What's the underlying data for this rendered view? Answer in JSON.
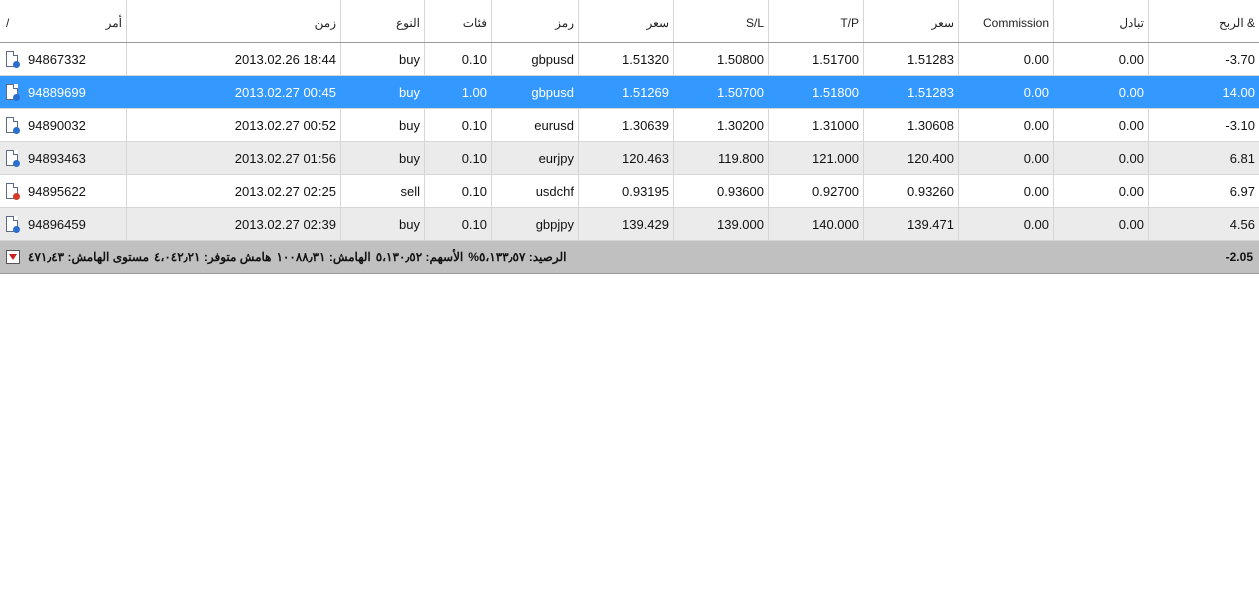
{
  "columns": {
    "order": "أمر",
    "sort_mark": "/",
    "time": "زمن",
    "type": "النوع",
    "lots": "فئات",
    "symbol": "رمز",
    "price_open": "سعر",
    "sl": "S/L",
    "tp": "T/P",
    "price_current": "سعر",
    "commission": "Commission",
    "swap": "تبادل",
    "profit": "الربح &"
  },
  "trades": [
    {
      "order": "94867332",
      "time": "2013.02.26 18:44",
      "type": "buy",
      "lots": "0.10",
      "symbol": "gbpusd",
      "price_open": "1.51320",
      "sl": "1.50800",
      "tp": "1.51700",
      "price_current": "1.51283",
      "commission": "0.00",
      "swap": "0.00",
      "profit": "-3.70"
    },
    {
      "order": "94889699",
      "time": "2013.02.27 00:45",
      "type": "buy",
      "lots": "1.00",
      "symbol": "gbpusd",
      "price_open": "1.51269",
      "sl": "1.50700",
      "tp": "1.51800",
      "price_current": "1.51283",
      "commission": "0.00",
      "swap": "0.00",
      "profit": "14.00"
    },
    {
      "order": "94890032",
      "time": "2013.02.27 00:52",
      "type": "buy",
      "lots": "0.10",
      "symbol": "eurusd",
      "price_open": "1.30639",
      "sl": "1.30200",
      "tp": "1.31000",
      "price_current": "1.30608",
      "commission": "0.00",
      "swap": "0.00",
      "profit": "-3.10"
    },
    {
      "order": "94893463",
      "time": "2013.02.27 01:56",
      "type": "buy",
      "lots": "0.10",
      "symbol": "eurjpy",
      "price_open": "120.463",
      "sl": "119.800",
      "tp": "121.000",
      "price_current": "120.400",
      "commission": "0.00",
      "swap": "0.00",
      "profit": "6.81"
    },
    {
      "order": "94895622",
      "time": "2013.02.27 02:25",
      "type": "sell",
      "lots": "0.10",
      "symbol": "usdchf",
      "price_open": "0.93195",
      "sl": "0.93600",
      "tp": "0.92700",
      "price_current": "0.93260",
      "commission": "0.00",
      "swap": "0.00",
      "profit": "6.97"
    },
    {
      "order": "94896459",
      "time": "2013.02.27 02:39",
      "type": "buy",
      "lots": "0.10",
      "symbol": "gbpjpy",
      "price_open": "139.429",
      "sl": "139.000",
      "tp": "140.000",
      "price_current": "139.471",
      "commission": "0.00",
      "swap": "0.00",
      "profit": "4.56"
    }
  ],
  "summary": {
    "balance": "%الرصيد: ٥،١٣٣٫٥٧",
    "equity": "الأسهم: ٥،١٣٠٫٥٢",
    "margin": "الهامش: ١٠٠٨٨٫٣١",
    "free_margin": "هامش متوفر: ٤،٠٤٢٫٢١",
    "margin_level": "مستوى الهامش: ٤٧١٫٤٣",
    "total_profit": "-2.05"
  },
  "colors": {
    "selected_row": "#3399ff",
    "summary_bar": "#c0c0c0",
    "alt_row": "#ebebeb"
  }
}
